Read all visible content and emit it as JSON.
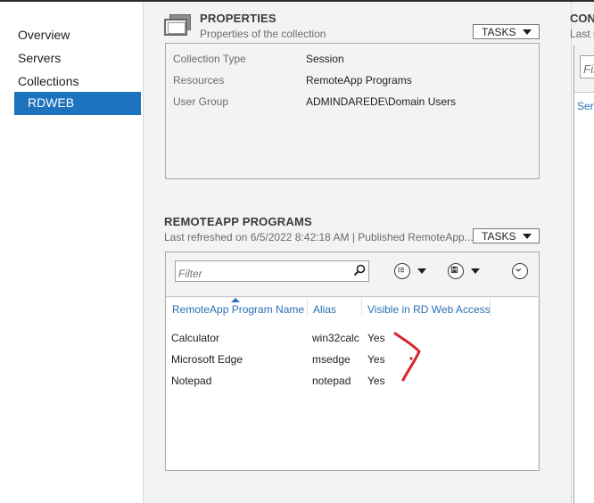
{
  "nav": {
    "items": [
      "Overview",
      "Servers",
      "Collections",
      "RDWEB"
    ]
  },
  "properties": {
    "title": "PROPERTIES",
    "subtitle": "Properties of the collection",
    "tasks_label": "TASKS",
    "rows": [
      {
        "label": "Collection Type",
        "value": "Session"
      },
      {
        "label": "Resources",
        "value": "RemoteApp Programs"
      },
      {
        "label": "User Group",
        "value": "ADMINDAREDE\\Domain Users"
      }
    ]
  },
  "remoteapp": {
    "title": "REMOTEAPP PROGRAMS",
    "subtitle": "Last refreshed on 6/5/2022 8:42:18 AM | Published RemoteApp...",
    "tasks_label": "TASKS",
    "filter_placeholder": "Filter",
    "columns": [
      "RemoteApp Program Name",
      "Alias",
      "Visible in RD Web Access"
    ],
    "rows": [
      {
        "name": "Calculator",
        "alias": "win32calc",
        "visible": "Yes"
      },
      {
        "name": "Microsoft Edge",
        "alias": "msedge",
        "visible": "Yes"
      },
      {
        "name": "Notepad",
        "alias": "notepad",
        "visible": "Yes"
      }
    ]
  },
  "right_section": {
    "title": "CONN",
    "subtitle": "Last r",
    "filter_placeholder": "Fil",
    "link": "Serv"
  },
  "annotation": {
    "color": "#d9232a"
  },
  "colors": {
    "accent": "#1e73be",
    "link": "#2a6fb3"
  }
}
